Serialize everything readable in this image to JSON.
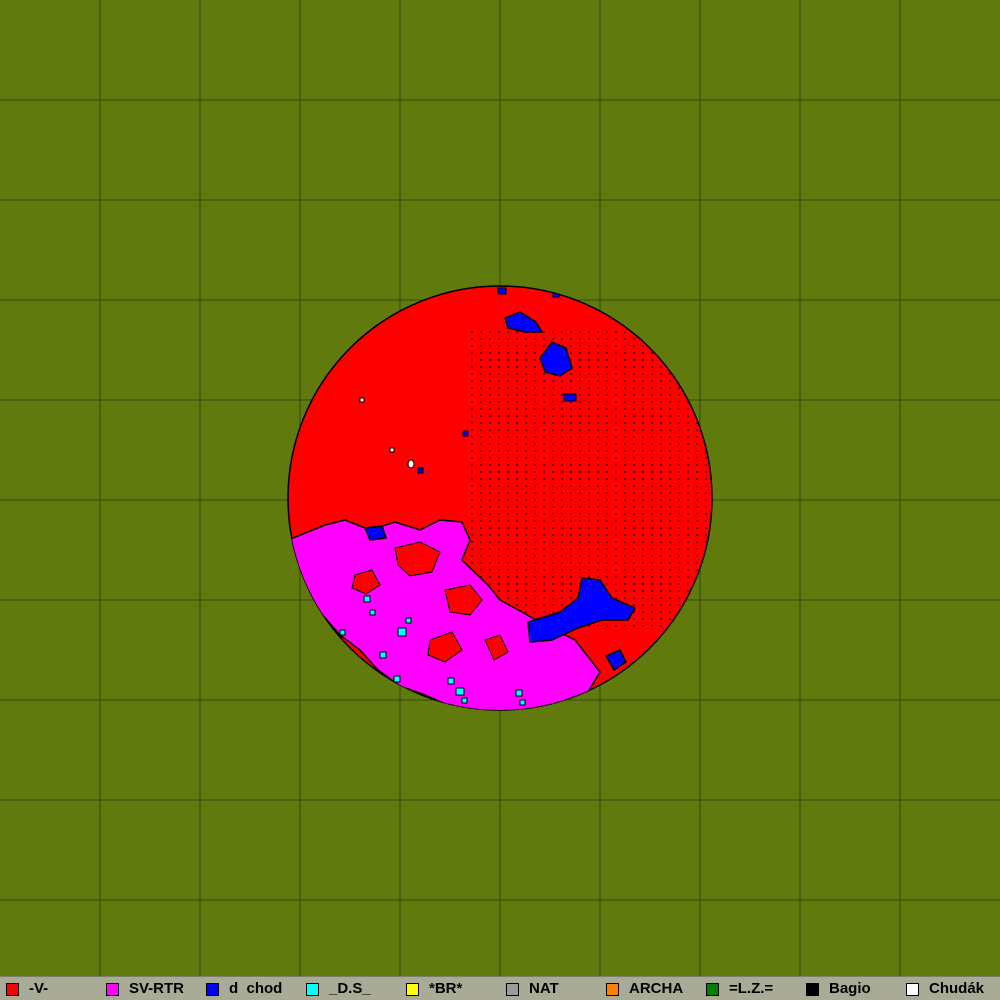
{
  "map": {
    "background_color": "#617a0d",
    "grid_color": "#2e4a10",
    "grid_cells": 10
  },
  "legend": {
    "items": [
      {
        "label": "-V-",
        "color": "#ff0000"
      },
      {
        "label": "SV-RTR",
        "color": "#ff00ff"
      },
      {
        "label": "d  chod",
        "color": "#0000ff"
      },
      {
        "label": "_D.S_",
        "color": "#00ffff"
      },
      {
        "label": "*BR*",
        "color": "#ffff00"
      },
      {
        "label": "NAT",
        "color": "#9a9a9a"
      },
      {
        "label": "ARCHA",
        "color": "#ff8000"
      },
      {
        "label": "=L.Z.=",
        "color": "#008000"
      },
      {
        "label": "Bagio",
        "color": "#000000"
      },
      {
        "label": "Chudák",
        "color": "#ffffff"
      }
    ]
  }
}
